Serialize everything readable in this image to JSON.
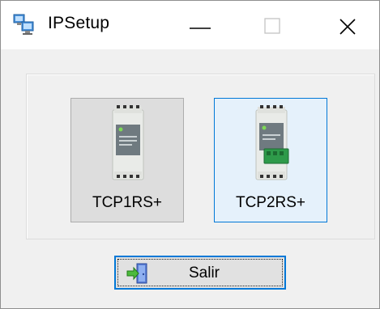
{
  "window": {
    "title": "IPSetup",
    "icon": "network-computers-icon",
    "controls": [
      "minimize-icon",
      "maximize-icon",
      "close-icon"
    ]
  },
  "devices": [
    {
      "label": "TCP1RS+",
      "icon": "din-rail-module-icon"
    },
    {
      "label": "TCP2RS+",
      "icon": "din-rail-module-green-connector-icon"
    }
  ],
  "exit_button": {
    "label": "Salir",
    "icon": "exit-door-arrow-icon"
  },
  "colors": {
    "focus_blue": "#0078d7",
    "connector_green": "#2e9a4a"
  }
}
